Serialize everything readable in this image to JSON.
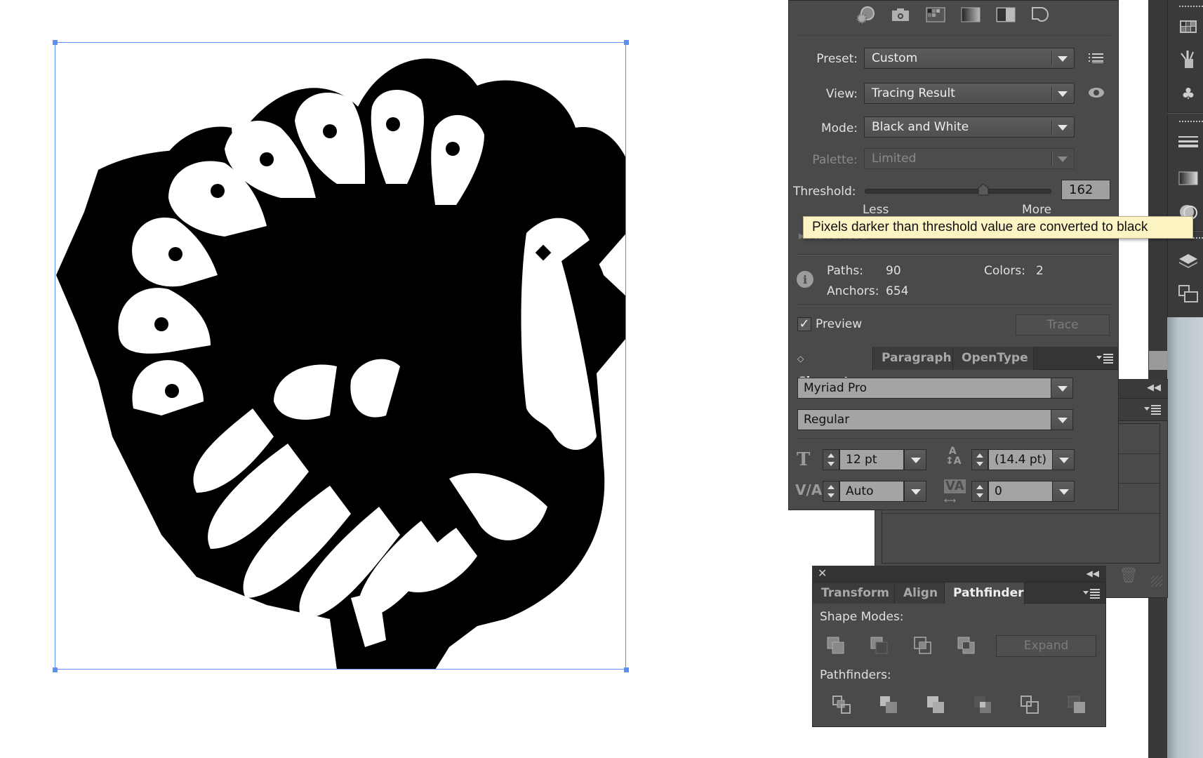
{
  "image_trace": {
    "toolbar_icons": [
      "auto-color-icon",
      "high-color-icon",
      "low-color-icon",
      "grayscale-icon",
      "black-and-white-icon",
      "outline-icon"
    ],
    "preset": {
      "label": "Preset:",
      "value": "Custom"
    },
    "view": {
      "label": "View:",
      "value": "Tracing Result"
    },
    "mode": {
      "label": "Mode:",
      "value": "Black and White"
    },
    "palette": {
      "label": "Palette:",
      "value": "Limited"
    },
    "threshold": {
      "label": "Threshold:",
      "value": "162",
      "value_num": 162,
      "min": 0,
      "max": 255,
      "less_label": "Less",
      "more_label": "More"
    },
    "tooltip": "Pixels darker than threshold value are converted to black",
    "advanced_label": "Advanced",
    "stats": {
      "paths_label": "Paths:",
      "paths": "90",
      "colors_label": "Colors:",
      "colors": "2",
      "anchors_label": "Anchors:",
      "anchors": "654"
    },
    "preview": {
      "label": "Preview",
      "checked": true
    },
    "trace_button": "Trace"
  },
  "character": {
    "tabs": [
      {
        "label": "Character",
        "active": true
      },
      {
        "label": "Paragraph",
        "active": false
      },
      {
        "label": "OpenType",
        "active": false
      }
    ],
    "font_family": "Myriad Pro",
    "font_style": "Regular",
    "font_size": "12 pt",
    "leading": "(14.4 pt)",
    "kerning": "Auto",
    "tracking": "0"
  },
  "pathfinder": {
    "tabs": [
      {
        "label": "Transform",
        "active": false
      },
      {
        "label": "Align",
        "active": false
      },
      {
        "label": "Pathfinder",
        "active": true
      }
    ],
    "shape_modes_label": "Shape Modes:",
    "shape_modes": [
      "unite-icon",
      "minus-front-icon",
      "intersect-icon",
      "exclude-icon"
    ],
    "expand_button": "Expand",
    "pathfinders_label": "Pathfinders:",
    "pathfinders": [
      "divide-icon",
      "trim-icon",
      "merge-icon",
      "crop-icon",
      "outline-icon",
      "minus-back-icon"
    ]
  },
  "dock_icons": [
    "swatches-icon",
    "brushes-icon",
    "symbols-icon",
    "stroke-icon",
    "gradient-icon",
    "transparency-icon",
    "layers-icon",
    "artboards-icon"
  ],
  "colors": {
    "selection": "#5b8ff9",
    "panel_bg": "#4a4a4a",
    "tooltip_bg": "#fdf4c4"
  }
}
